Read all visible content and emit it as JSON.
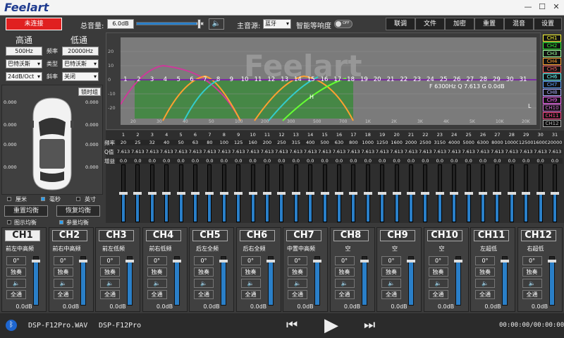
{
  "titlebar": {
    "logo": "Feelart",
    "min": "—",
    "max": "☐",
    "close": "✕"
  },
  "toolbar": {
    "status": "未连接",
    "master_label": "总音量:",
    "master_value": "6.0dB",
    "source_label": "主音源:",
    "source_value": "蓝牙",
    "smart_label": "智能等响度",
    "toggle": "OFF",
    "buttons": [
      "联调",
      "文件",
      "加密",
      "重置",
      "混音",
      "设置"
    ]
  },
  "filter": {
    "hp_title": "高通",
    "lp_title": "低通",
    "hp_freq": "500Hz",
    "lp_freq": "20000Hz",
    "freq_label": "频率",
    "hp_type": "巴特沃斯",
    "lp_type": "巴特沃斯",
    "type_label": "类型",
    "hp_slope": "24dB/Oct",
    "lp_slope": "关闭",
    "slope_label": "斜率"
  },
  "delay": {
    "link": "锁时组",
    "values": [
      "0.000",
      "0.000",
      "0.000",
      "0.000",
      "0.000",
      "0.000",
      "0.000",
      "0.000"
    ],
    "units": [
      "厘米",
      "毫秒",
      "英寸"
    ],
    "reset": "重置均衡",
    "restore": "恢复均衡",
    "show": "图示均衡",
    "param": "参量均衡"
  },
  "graph": {
    "logo": "Feelart",
    "info": "F 6300Hz Q 7.613 G 0.0dB",
    "bands": [
      "1",
      "2",
      "3",
      "4",
      "5",
      "6",
      "7",
      "8",
      "9",
      "10",
      "11",
      "12",
      "13",
      "14",
      "15",
      "16",
      "17",
      "18",
      "19",
      "20",
      "21",
      "22",
      "23",
      "24",
      "25",
      "26",
      "27",
      "28",
      "29",
      "30",
      "31"
    ],
    "xticks": [
      "20",
      "30",
      "40",
      "50",
      "100",
      "200",
      "300",
      "500",
      "700",
      "1K",
      "2K",
      "3K",
      "4K",
      "5K",
      "10K",
      "20K"
    ],
    "yticks": [
      "20",
      "10",
      "0",
      "-10",
      "-20"
    ]
  },
  "legend": [
    "CH1",
    "CH2",
    "CH3",
    "CH4",
    "CH5",
    "CH6",
    "CH7",
    "CH8",
    "CH9",
    "CH10",
    "CH11",
    "CH12"
  ],
  "legend_colors": [
    "#ffff33",
    "#33ff33",
    "#9aff9a",
    "#ffa030",
    "#ff6666",
    "#66ffff",
    "#5aa0ff",
    "#aaaaff",
    "#ff66ff",
    "#cc66cc",
    "#ff4488",
    "#aaaaaa"
  ],
  "eq": {
    "row_labels": [
      "频率",
      "Q值",
      "增益"
    ],
    "freqs": [
      "20",
      "25",
      "32",
      "40",
      "50",
      "63",
      "80",
      "100",
      "125",
      "160",
      "200",
      "250",
      "315",
      "400",
      "500",
      "630",
      "800",
      "1000",
      "1250",
      "1600",
      "2000",
      "2500",
      "3150",
      "4000",
      "5000",
      "6300",
      "8000",
      "10000",
      "12500",
      "16000",
      "20000"
    ],
    "q": "7.613",
    "gain": "0.0"
  },
  "channels": [
    {
      "name": "CH1",
      "label": "前左中高频",
      "phase": "0°",
      "solo": "独奏",
      "mute": "🔈",
      "pass": "全通",
      "db": "0.0dB"
    },
    {
      "name": "CH2",
      "label": "前右中高频",
      "phase": "0°",
      "solo": "独奏",
      "mute": "🔈",
      "pass": "全通",
      "db": "0.0dB"
    },
    {
      "name": "CH3",
      "label": "前左低频",
      "phase": "0°",
      "solo": "独奏",
      "mute": "🔈",
      "pass": "全通",
      "db": "0.0dB"
    },
    {
      "name": "CH4",
      "label": "前右低频",
      "phase": "0°",
      "solo": "独奏",
      "mute": "🔈",
      "pass": "全通",
      "db": "0.0dB"
    },
    {
      "name": "CH5",
      "label": "后左全频",
      "phase": "0°",
      "solo": "独奏",
      "mute": "🔈",
      "pass": "全通",
      "db": "0.0dB"
    },
    {
      "name": "CH6",
      "label": "后右全频",
      "phase": "0°",
      "solo": "独奏",
      "mute": "🔈",
      "pass": "全通",
      "db": "0.0dB"
    },
    {
      "name": "CH7",
      "label": "中置中高频",
      "phase": "0°",
      "solo": "独奏",
      "mute": "🔈",
      "pass": "全通",
      "db": "0.0dB"
    },
    {
      "name": "CH8",
      "label": "空",
      "phase": "0°",
      "solo": "独奏",
      "mute": "🔈",
      "pass": "全通",
      "db": "0.0dB"
    },
    {
      "name": "CH9",
      "label": "空",
      "phase": "0°",
      "solo": "独奏",
      "mute": "🔈",
      "pass": "全通",
      "db": "0.0dB"
    },
    {
      "name": "CH10",
      "label": "空",
      "phase": "0°",
      "solo": "独奏",
      "mute": "🔈",
      "pass": "全通",
      "db": "0.0dB"
    },
    {
      "name": "CH11",
      "label": "左超低",
      "phase": "0°",
      "solo": "独奏",
      "mute": "🔈",
      "pass": "全通",
      "db": "0.0dB"
    },
    {
      "name": "CH12",
      "label": "右超低",
      "phase": "0°",
      "solo": "独奏",
      "mute": "🔈",
      "pass": "全通",
      "db": "0.0dB"
    }
  ],
  "player": {
    "file1": "DSP-F12Pro.WAV",
    "file2": "DSP-F12Pro",
    "time": "00:00:00/00:00:00"
  }
}
